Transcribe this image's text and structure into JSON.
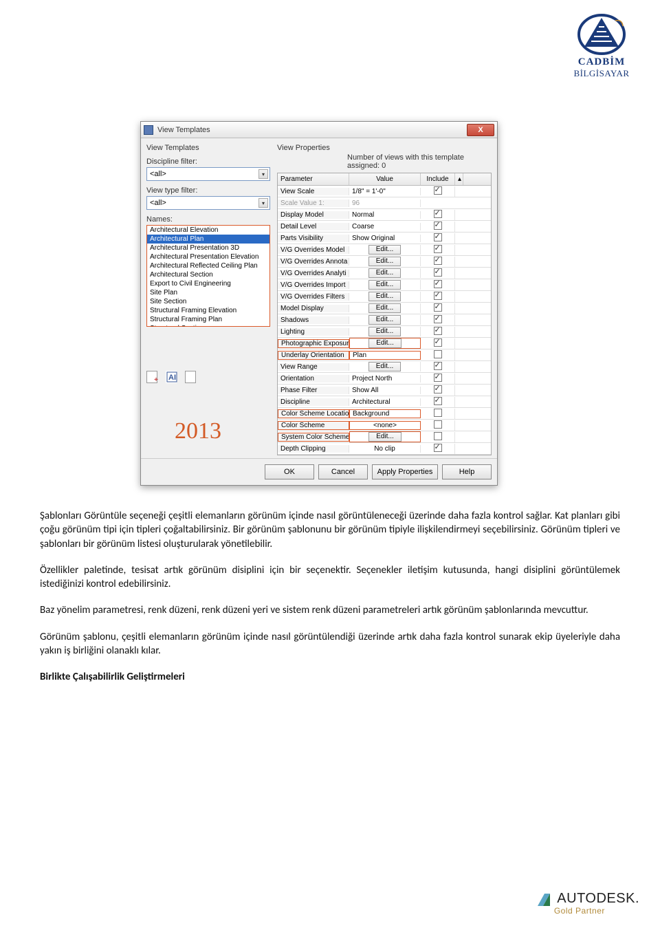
{
  "brand": {
    "name": "CADBİM",
    "sub": "BİLGİSAYAR"
  },
  "dialog": {
    "title": "View Templates",
    "left": {
      "header": "View Templates",
      "disc_filter_label": "Discipline filter:",
      "disc_filter_value": "<all>",
      "vtype_filter_label": "View type filter:",
      "vtype_filter_value": "<all>",
      "names_label": "Names:",
      "names": [
        "Architectural Elevation",
        "Architectural Plan",
        "Architectural Presentation 3D",
        "Architectural Presentation Elevation",
        "Architectural Reflected Ceiling Plan",
        "Architectural Section",
        "Export to Civil Engineering",
        "Site Plan",
        "Site Section",
        "Structural Framing Elevation",
        "Structural Framing Plan",
        "Structural Section"
      ],
      "selected_index": 1
    },
    "right": {
      "header": "View Properties",
      "count_label": "Number of views with this template assigned: 0",
      "columns": {
        "param": "Parameter",
        "value": "Value",
        "include": "Include"
      },
      "rows": [
        {
          "p": "View Scale",
          "v": "1/8\" = 1'-0\"",
          "btn": false,
          "inc": true,
          "grayP": false
        },
        {
          "p": "Scale Value    1:",
          "v": "96",
          "btn": false,
          "inc": null,
          "grayP": true,
          "grayV": true
        },
        {
          "p": "Display Model",
          "v": "Normal",
          "btn": false,
          "inc": true
        },
        {
          "p": "Detail Level",
          "v": "Coarse",
          "btn": false,
          "inc": true
        },
        {
          "p": "Parts Visibility",
          "v": "Show Original",
          "btn": false,
          "inc": true
        },
        {
          "p": "V/G Overrides Model",
          "v": "Edit...",
          "btn": true,
          "inc": true
        },
        {
          "p": "V/G Overrides Annota",
          "v": "Edit...",
          "btn": true,
          "inc": true
        },
        {
          "p": "V/G Overrides Analyti",
          "v": "Edit...",
          "btn": true,
          "inc": true
        },
        {
          "p": "V/G Overrides Import",
          "v": "Edit...",
          "btn": true,
          "inc": true
        },
        {
          "p": "V/G Overrides Filters",
          "v": "Edit...",
          "btn": true,
          "inc": true
        },
        {
          "p": "Model Display",
          "v": "Edit...",
          "btn": true,
          "inc": true
        },
        {
          "p": "Shadows",
          "v": "Edit...",
          "btn": true,
          "inc": true
        },
        {
          "p": "Lighting",
          "v": "Edit...",
          "btn": true,
          "inc": true
        },
        {
          "p": "Photographic Exposur",
          "v": "Edit...",
          "btn": true,
          "inc": true,
          "orange": true
        },
        {
          "p": "Underlay Orientation",
          "v": "Plan",
          "btn": false,
          "inc": false,
          "orange": true
        },
        {
          "p": "View Range",
          "v": "Edit...",
          "btn": true,
          "inc": true
        },
        {
          "p": "Orientation",
          "v": "Project North",
          "btn": false,
          "inc": true
        },
        {
          "p": "Phase Filter",
          "v": "Show All",
          "btn": false,
          "inc": true
        },
        {
          "p": "Discipline",
          "v": "Architectural",
          "btn": false,
          "inc": true
        },
        {
          "p": "Color Scheme Locatio",
          "v": "Background",
          "btn": false,
          "inc": false,
          "orange": true
        },
        {
          "p": "Color Scheme",
          "v": "<none>",
          "btn": false,
          "inc": false,
          "orange": true,
          "center": true
        },
        {
          "p": "System Color Scheme",
          "v": "Edit...",
          "btn": true,
          "inc": false,
          "orange": true
        },
        {
          "p": "Depth Clipping",
          "v": "No clip",
          "btn": false,
          "inc": true,
          "center": true
        }
      ]
    },
    "buttons": {
      "ok": "OK",
      "cancel": "Cancel",
      "apply": "Apply Properties",
      "help": "Help"
    },
    "year": "2013"
  },
  "article": {
    "p1": "Şablonları Görüntüle seçeneği çeşitli elemanların görünüm içinde nasıl görüntüleneceği üzerinde daha fazla kontrol sağlar. Kat planları gibi çoğu görünüm tipi için tipleri çoğaltabilirsiniz. Bir görünüm şablonunu bir görünüm tipiyle ilişkilendirmeyi seçebilirsiniz. Görünüm tipleri ve şablonları bir görünüm listesi oluşturularak yönetilebilir.",
    "p2": "Özellikler paletinde, tesisat artık görünüm disiplini için bir seçenektir. Seçenekler iletişim kutusunda, hangi disiplini görüntülemek istediğinizi kontrol edebilirsiniz.",
    "p3": "Baz yönelim parametresi, renk düzeni, renk düzeni yeri ve sistem renk düzeni parametreleri artık görünüm şablonlarında mevcuttur.",
    "p4": "Görünüm şablonu, çeşitli elemanların görünüm içinde nasıl görüntülendiği üzerinde artık daha fazla kontrol sunarak ekip üyeleriyle daha yakın iş birliğini olanaklı kılar.",
    "p5": "Birlikte Çalışabilirlik Geliştirmeleri"
  },
  "footer": {
    "brand": "AUTODESK.",
    "sub": "Gold Partner"
  }
}
